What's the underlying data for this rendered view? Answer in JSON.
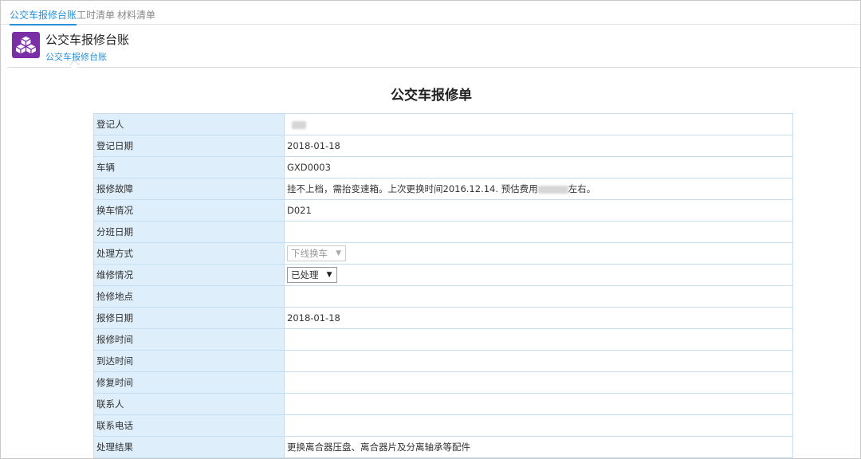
{
  "tabs": [
    "公交车报修台账",
    "工时清单",
    "材料清单"
  ],
  "header": {
    "title": "公交车报修台账",
    "breadcrumb": "公交车报修台账"
  },
  "form": {
    "title": "公交车报修单",
    "rows": [
      {
        "label": "登记人",
        "value": ""
      },
      {
        "label": "登记日期",
        "value": "2018-01-18"
      },
      {
        "label": "车辆",
        "value": "GXD0003"
      },
      {
        "label": "报修故障",
        "value": "挂不上档，需抬变速箱。上次更换时间2016.12.14. 预估费用",
        "value_suffix": "左右。"
      },
      {
        "label": "换车情况",
        "value": "D021"
      },
      {
        "label": "分班日期",
        "value": ""
      },
      {
        "label": "处理方式",
        "select": "下线换车"
      },
      {
        "label": "维修情况",
        "select": "已处理"
      },
      {
        "label": "抢修地点",
        "value": ""
      },
      {
        "label": "报修日期",
        "value": "2018-01-18"
      },
      {
        "label": "报修时间",
        "value": ""
      },
      {
        "label": "到达时间",
        "value": ""
      },
      {
        "label": "修复时间",
        "value": ""
      },
      {
        "label": "联系人",
        "value": ""
      },
      {
        "label": "联系电话",
        "value": ""
      },
      {
        "label": "处理结果",
        "value": "更换离合器压盘、离合器片及分离轴承等配件"
      }
    ]
  },
  "colors": {
    "accent": "#2a8fd6",
    "label_bg": "#deeefa",
    "app_icon": "#7b2fa6"
  }
}
